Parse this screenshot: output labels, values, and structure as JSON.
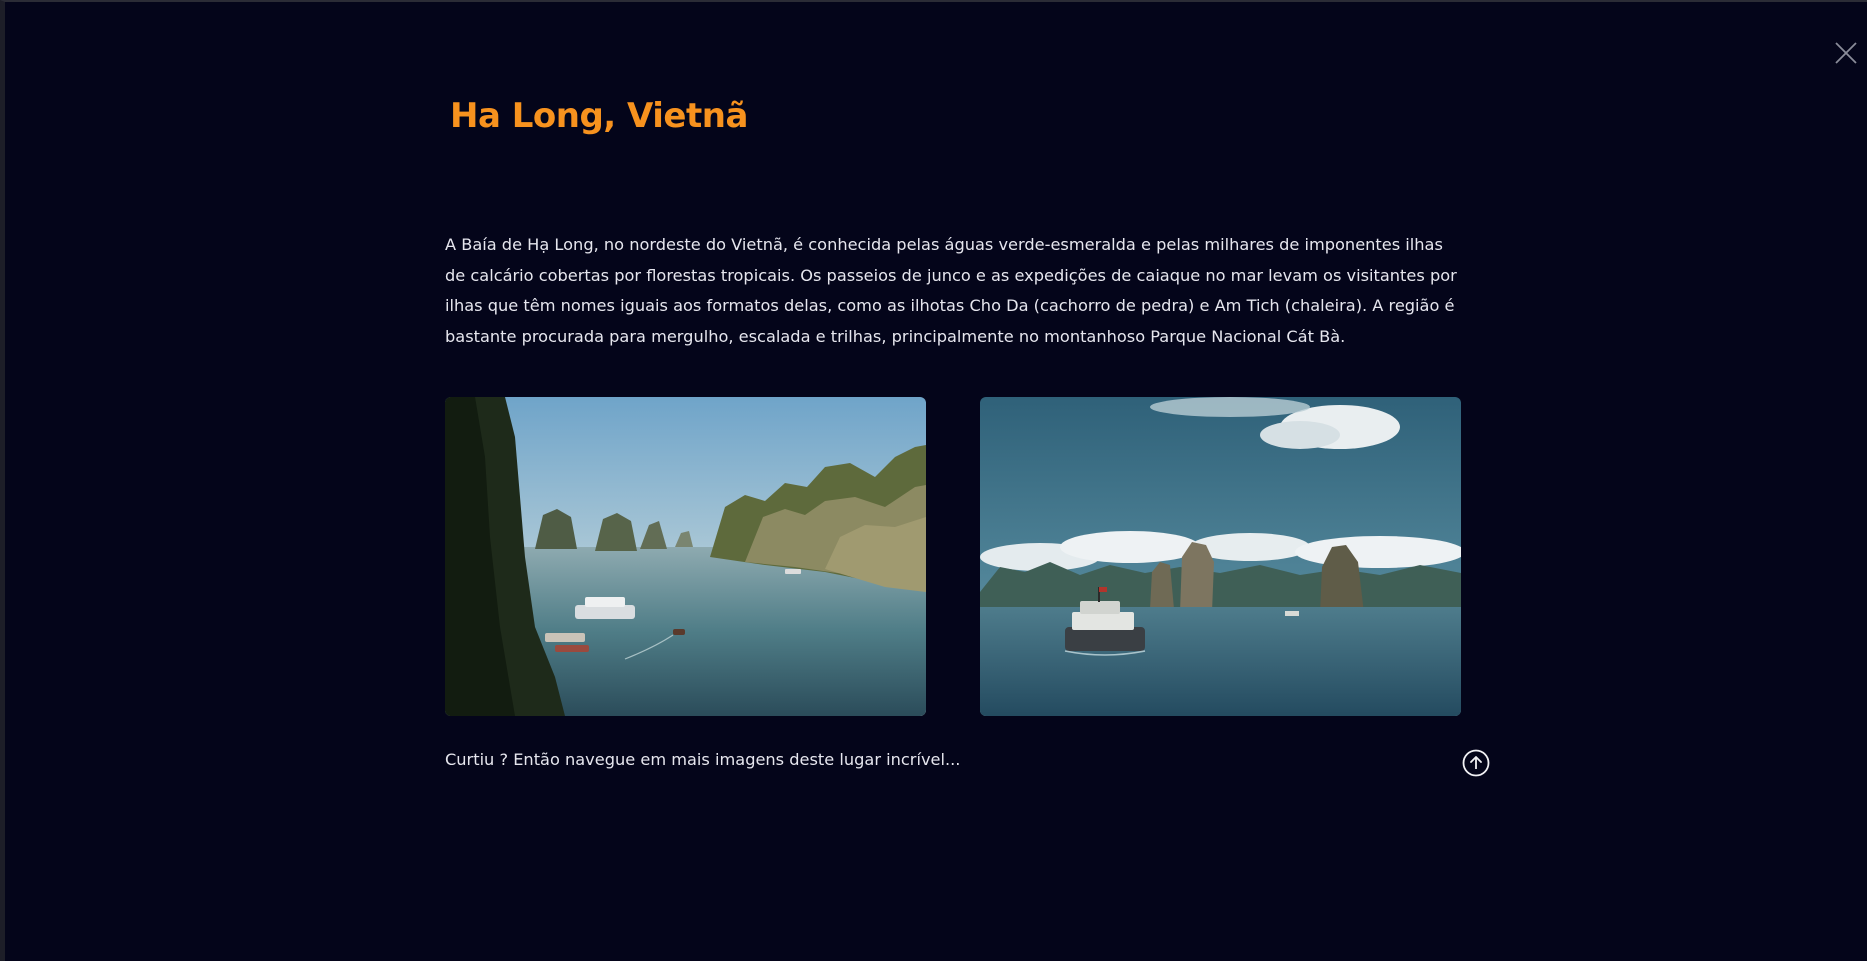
{
  "modal": {
    "title": "Ha Long, Vietnã",
    "description": "A Baía de Hạ Long, no nordeste do Vietnã, é conhecida pelas águas verde-esmeralda e pelas milhares de imponentes ilhas de calcário cobertas por florestas tropicais. Os passeios de junco e as expedições de caiaque no mar levam os visitantes por ilhas que têm nomes iguais aos formatos delas, como as ilhotas Cho Da (cachorro de pedra) e Am Tich (chaleira). A região é bastante procurada para mergulho, escalada e trilhas, principalmente no montanhoso Parque Nacional Cát Bà.",
    "footer_text": "Curtiu ? Então navegue em mais imagens deste lugar incrível...",
    "close_icon": "close-icon",
    "scroll_icon": "arrow-up-circle-icon"
  },
  "colors": {
    "background": "#04051a",
    "title": "#f7921e",
    "text": "#e6e6ee"
  }
}
